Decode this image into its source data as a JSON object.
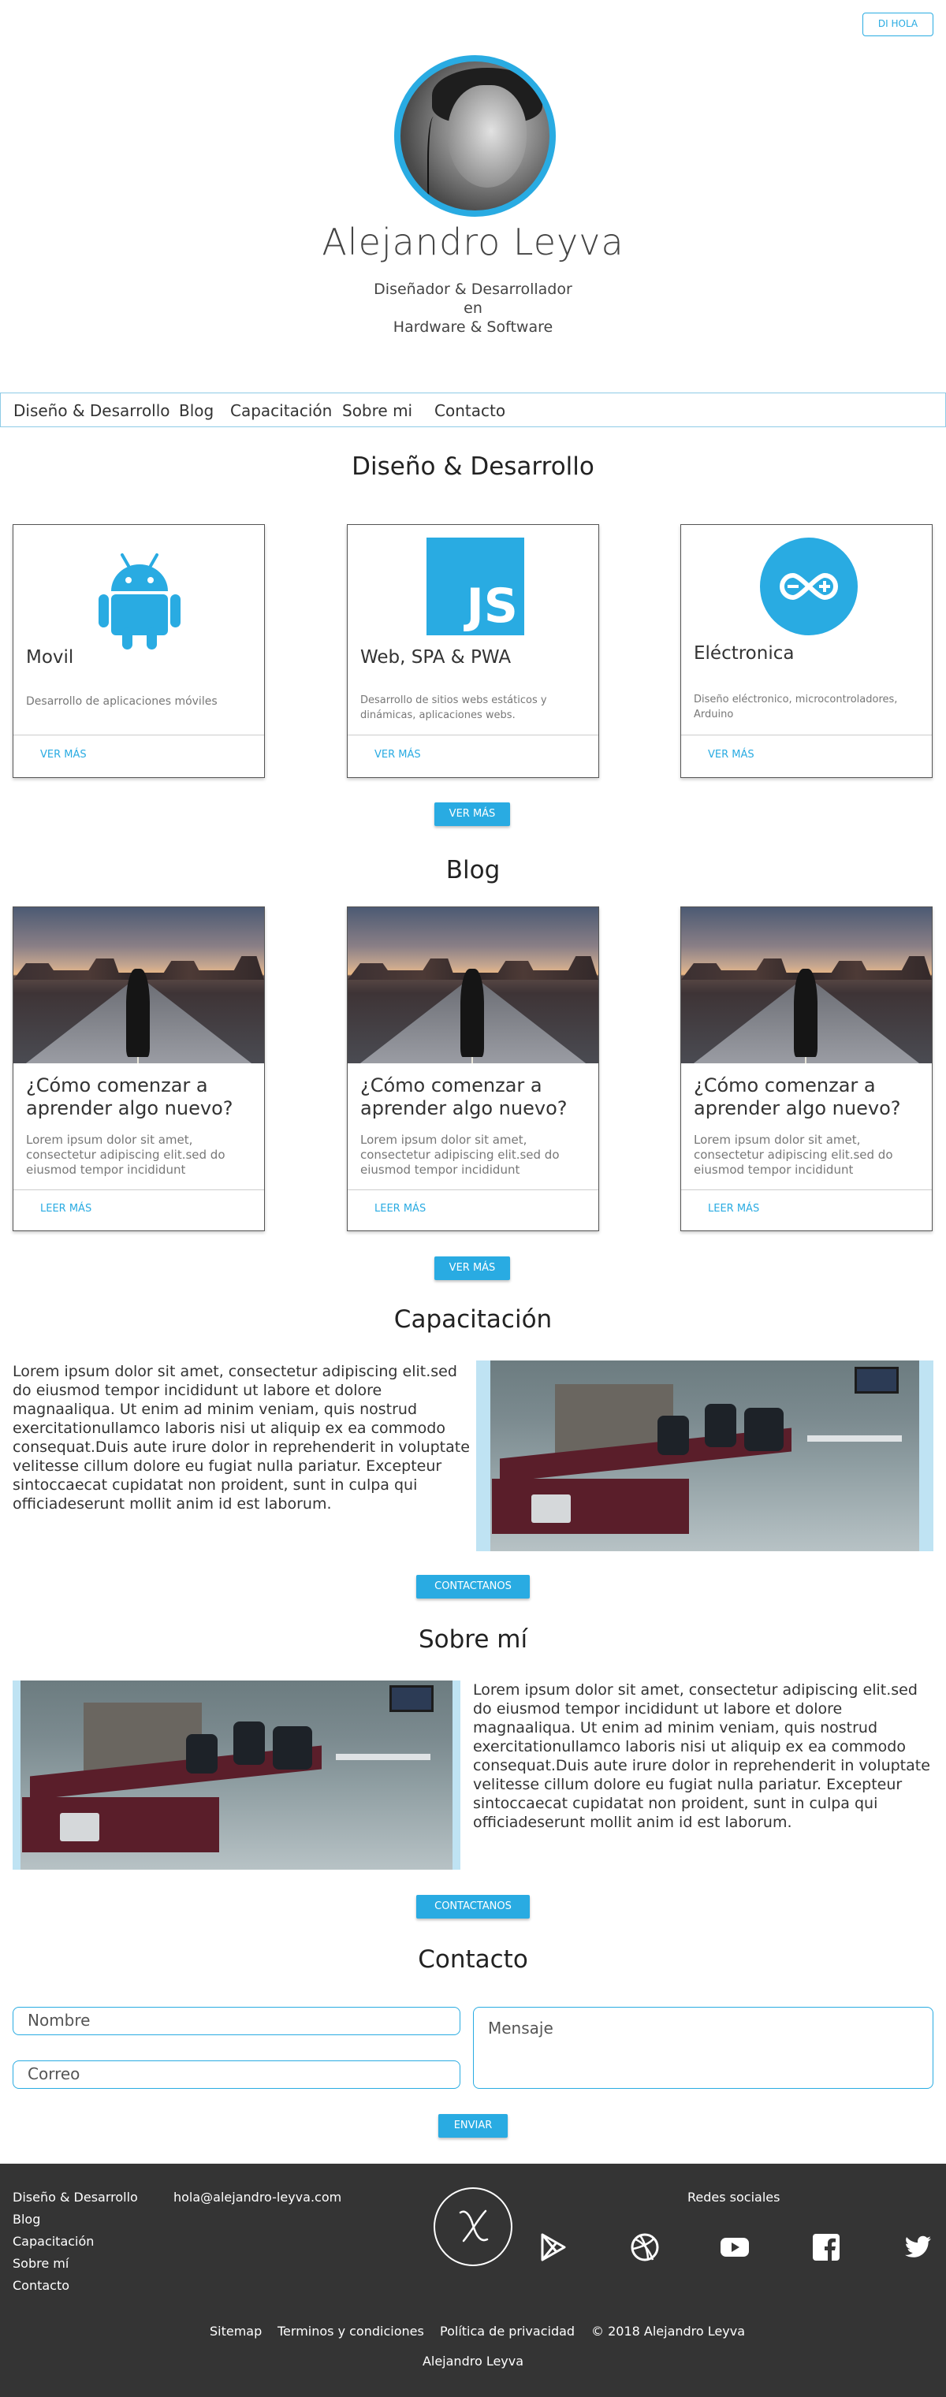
{
  "header": {
    "hello_button": "DI HOLA",
    "name": "Alejandro Leyva",
    "tagline": [
      "Diseñador & Desarrollador",
      "en",
      "Hardware & Software"
    ]
  },
  "nav": {
    "items": [
      "Diseño & Desarrollo",
      "Blog",
      "Capacitación",
      "Sobre mi",
      "Contacto"
    ]
  },
  "design": {
    "title": "Diseño & Desarrollo",
    "cards": [
      {
        "icon": "android-icon",
        "title": "Movil",
        "desc": "Desarrollo de aplicaciones móviles",
        "link": "VER MÁS"
      },
      {
        "icon": "javascript-icon",
        "title": "Web, SPA & PWA",
        "desc": "Desarrollo de sitios webs estáticos y dinámicas, aplicaciones webs.",
        "link": "VER MÁS"
      },
      {
        "icon": "arduino-icon",
        "title": "Eléctronica",
        "desc": "Diseño eléctronico, microcontroladores, Arduino",
        "link": "VER MÁS"
      }
    ],
    "more_button": "VER MÁS"
  },
  "blog": {
    "title": "Blog",
    "posts": [
      {
        "title": "¿Cómo comenzar a aprender algo nuevo?",
        "excerpt": "Lorem ipsum dolor sit amet, consectetur adipiscing elit.sed do eiusmod tempor incididunt",
        "link": "LEER MÁS"
      },
      {
        "title": "¿Cómo comenzar a aprender algo nuevo?",
        "excerpt": "Lorem ipsum dolor sit amet, consectetur adipiscing elit.sed do eiusmod tempor incididunt",
        "link": "LEER MÁS"
      },
      {
        "title": "¿Cómo comenzar a aprender algo nuevo?",
        "excerpt": "Lorem ipsum dolor sit amet, consectetur adipiscing elit.sed do eiusmod tempor incididunt",
        "link": "LEER MÁS"
      }
    ],
    "more_button": "VER MÁS"
  },
  "training": {
    "title": "Capacitación",
    "text": "Lorem ipsum dolor sit amet, consectetur adipiscing elit.sed do eiusmod tempor incididunt ut labore et dolore magnaaliqua. Ut enim ad minim veniam, quis nostrud exercitationullamco laboris nisi ut aliquip ex ea commodo consequat.Duis aute irure dolor in reprehenderit in voluptate velitesse cillum dolore eu fugiat nulla pariatur. Excepteur sintoccaecat cupidatat non proident, sunt in culpa qui officiadeserunt mollit anim id est laborum.",
    "button": "CONTACTANOS"
  },
  "about": {
    "title": "Sobre mí",
    "text": "Lorem ipsum dolor sit amet, consectetur adipiscing elit.sed do eiusmod tempor incididunt ut labore et dolore magnaaliqua. Ut enim ad minim veniam, quis nostrud exercitationullamco laboris nisi ut aliquip ex ea commodo consequat.Duis aute irure dolor in reprehenderit in voluptate velitesse cillum dolore eu fugiat nulla pariatur. Excepteur sintoccaecat cupidatat non proident, sunt in culpa qui officiadeserunt mollit anim id est laborum.",
    "button": "CONTACTANOS"
  },
  "contact": {
    "title": "Contacto",
    "name_placeholder": "Nombre",
    "email_placeholder": "Correo",
    "message_placeholder": "Mensaje",
    "send_button": "ENVIAR"
  },
  "footer": {
    "links": [
      "Diseño & Desarrollo",
      "Blog",
      "Capacitación",
      "Sobre mí",
      "Contacto"
    ],
    "email": "hola@alejandro-leyva.com",
    "social_title": "Redes sociales",
    "social_icons": [
      "google-play-icon",
      "dribbble-icon",
      "youtube-icon",
      "facebook-icon",
      "twitter-icon"
    ],
    "bottom_links": [
      "Sitemap",
      "Terminos y condiciones",
      "Política de privacidad",
      "© 2018 Alejandro Leyva"
    ],
    "signature": "Alejandro Leyva"
  },
  "colors": {
    "accent": "#29abe2",
    "footer_bg": "#343434"
  }
}
